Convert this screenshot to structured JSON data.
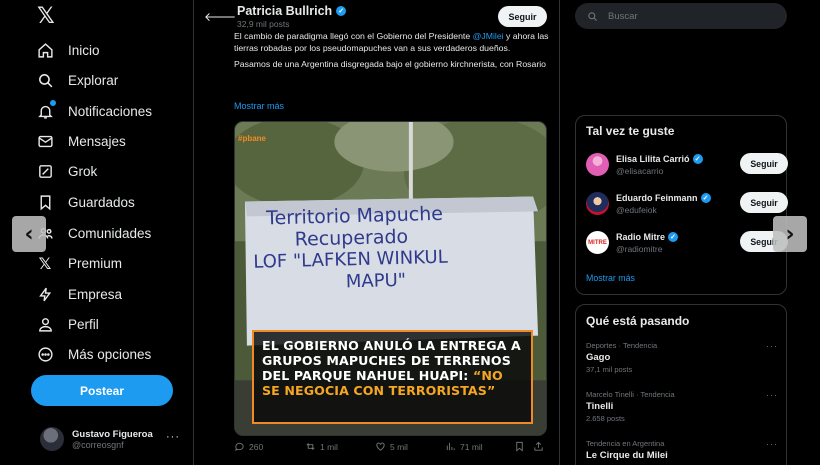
{
  "nav": {
    "items": [
      {
        "label": "Inicio",
        "icon": "home-icon"
      },
      {
        "label": "Explorar",
        "icon": "search-icon"
      },
      {
        "label": "Notificaciones",
        "icon": "bell-icon"
      },
      {
        "label": "Mensajes",
        "icon": "mail-icon"
      },
      {
        "label": "Grok",
        "icon": "grok-icon"
      },
      {
        "label": "Guardados",
        "icon": "bookmark-icon"
      },
      {
        "label": "Comunidades",
        "icon": "people-icon"
      },
      {
        "label": "Premium",
        "icon": "x-logo-icon"
      },
      {
        "label": "Empresa",
        "icon": "lightning-icon"
      },
      {
        "label": "Perfil",
        "icon": "person-icon"
      },
      {
        "label": "Más opciones",
        "icon": "more-circle-icon"
      }
    ],
    "post_label": "Postear",
    "account": {
      "name": "Gustavo Figueroa",
      "handle": "@correosgnf"
    }
  },
  "header": {
    "name": "Patricia Bullrich",
    "post_count": "32,9 mil posts",
    "follow_label": "Seguir"
  },
  "tweet": {
    "text_1a": "El cambio de paradigma llegó con el Gobierno del Presidente ",
    "mention": "@JMilei",
    "text_1b": " y ahora las tierras robadas por los pseudomapuches van a sus verdaderos dueños.",
    "text_2": "Pasamos de una Argentina disgregada bajo el gobierno kirchnerista, con Rosario",
    "show_more": "Mostrar más",
    "media": {
      "banner_lines": [
        "Territorio Mapuche",
        "Recuperado",
        "LOF \"LAFKEN WINKUL",
        "MAPU\""
      ],
      "caption": "EL GOBIERNO ANULÓ LA ENTREGA A GRUPOS MAPUCHES DE TERRENOS DEL PARQUE NAHUEL HUAPI:",
      "caption_highlight": "“NO SE NEGOCIA CON TERRORISTAS”",
      "watermark": "#pbane"
    },
    "stats": {
      "replies": "260",
      "reposts": "1 mil",
      "likes": "5 mil",
      "views": "71 mil"
    }
  },
  "search": {
    "placeholder": "Buscar"
  },
  "suggestions": {
    "title": "Tal vez te guste",
    "items": [
      {
        "name": "Elisa Lilita Carrió",
        "handle": "@elisacarrio",
        "button": "Seguir",
        "avatar_color": "#e25db4"
      },
      {
        "name": "Eduardo Feinmann",
        "handle": "@edufeiok",
        "button": "Seguir",
        "avatar_color": "#c8102e"
      },
      {
        "name": "Radio Mitre",
        "handle": "@radiomitre",
        "button": "Seguir",
        "avatar_color": "#d9261c"
      }
    ],
    "more": "Mostrar más"
  },
  "trends": {
    "title": "Qué está pasando",
    "items": [
      {
        "category": "Deportes · Tendencia",
        "title": "Gago",
        "count": "37,1 mil posts"
      },
      {
        "category": "Marcelo Tinelli · Tendencia",
        "title": "Tinelli",
        "count": "2.658 posts"
      },
      {
        "category": "Tendencia en Argentina",
        "title": "Le Cirque du Milei",
        "count": ""
      }
    ]
  },
  "colors": {
    "accent": "#1d9bf0",
    "caption_border": "#f08a24",
    "caption_highlight": "#f5a623"
  }
}
